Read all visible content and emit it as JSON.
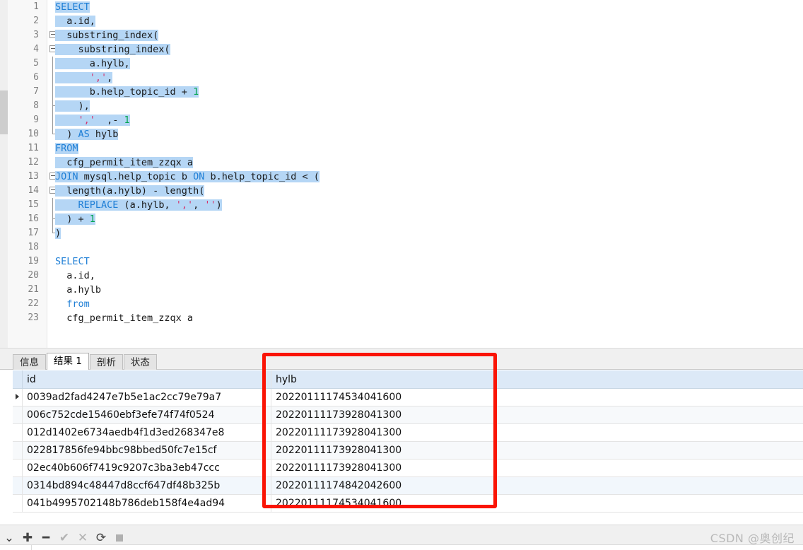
{
  "editor": {
    "language": "sql",
    "total_lines": 23,
    "selection_active": true,
    "colors": {
      "keyword": "#1f7fd6",
      "string": "#d6336c",
      "number": "#00a550",
      "plain": "#1a1a1a",
      "selection": "#b5d6f5",
      "gutter_bg": "#f8f8f8",
      "line_number": "#808080"
    },
    "lines": [
      {
        "n": "1",
        "fold": "none",
        "selected": true,
        "tokens": [
          {
            "t": "SELECT",
            "c": "kw"
          }
        ]
      },
      {
        "n": "2",
        "fold": "none",
        "selected": true,
        "tokens": [
          {
            "t": "  a.id,",
            "c": "pln"
          }
        ]
      },
      {
        "n": "3",
        "fold": "box",
        "selected": true,
        "tokens": [
          {
            "t": "  substring_index(",
            "c": "pln"
          }
        ]
      },
      {
        "n": "4",
        "fold": "box",
        "selected": true,
        "tokens": [
          {
            "t": "    substring_index(",
            "c": "pln"
          }
        ]
      },
      {
        "n": "5",
        "fold": "line",
        "selected": true,
        "tokens": [
          {
            "t": "      a.hylb,",
            "c": "pln"
          }
        ]
      },
      {
        "n": "6",
        "fold": "line",
        "selected": true,
        "tokens": [
          {
            "t": "      ",
            "c": "pln"
          },
          {
            "t": "','",
            "c": "str"
          },
          {
            "t": ",",
            "c": "pln"
          }
        ]
      },
      {
        "n": "7",
        "fold": "line",
        "selected": true,
        "tokens": [
          {
            "t": "      b.help_topic_id + ",
            "c": "pln"
          },
          {
            "t": "1",
            "c": "num"
          }
        ]
      },
      {
        "n": "8",
        "fold": "tick",
        "selected": true,
        "tokens": [
          {
            "t": "    ),",
            "c": "pln"
          }
        ]
      },
      {
        "n": "9",
        "fold": "line",
        "selected": true,
        "tokens": [
          {
            "t": "    ",
            "c": "pln"
          },
          {
            "t": "','",
            "c": "str"
          },
          {
            "t": "  ,- ",
            "c": "pln"
          },
          {
            "t": "1",
            "c": "num"
          }
        ]
      },
      {
        "n": "10",
        "fold": "end",
        "selected": true,
        "tokens": [
          {
            "t": "  ) ",
            "c": "pln"
          },
          {
            "t": "AS",
            "c": "kw"
          },
          {
            "t": " hylb",
            "c": "pln"
          }
        ]
      },
      {
        "n": "11",
        "fold": "none",
        "selected": true,
        "tokens": [
          {
            "t": "FROM",
            "c": "kw"
          }
        ]
      },
      {
        "n": "12",
        "fold": "none",
        "selected": true,
        "tokens": [
          {
            "t": "  cfg_permit_item_zzqx a",
            "c": "pln"
          }
        ]
      },
      {
        "n": "13",
        "fold": "box",
        "selected": true,
        "tokens": [
          {
            "t": "JOIN",
            "c": "kw"
          },
          {
            "t": " mysql.help_topic b ",
            "c": "pln"
          },
          {
            "t": "ON",
            "c": "kw"
          },
          {
            "t": " b.help_topic_id < (",
            "c": "pln"
          }
        ]
      },
      {
        "n": "14",
        "fold": "box",
        "selected": true,
        "tokens": [
          {
            "t": "  length(a.hylb) - length(",
            "c": "pln"
          }
        ]
      },
      {
        "n": "15",
        "fold": "line",
        "selected": true,
        "tokens": [
          {
            "t": "    ",
            "c": "pln"
          },
          {
            "t": "REPLACE",
            "c": "kw"
          },
          {
            "t": " (a.hylb, ",
            "c": "pln"
          },
          {
            "t": "','",
            "c": "str"
          },
          {
            "t": ", ",
            "c": "pln"
          },
          {
            "t": "''",
            "c": "str"
          },
          {
            "t": ")",
            "c": "pln"
          }
        ]
      },
      {
        "n": "16",
        "fold": "tick",
        "selected": true,
        "tokens": [
          {
            "t": "  ) + ",
            "c": "pln"
          },
          {
            "t": "1",
            "c": "num"
          }
        ]
      },
      {
        "n": "17",
        "fold": "end",
        "selected": true,
        "tokens": [
          {
            "t": ")",
            "c": "pln"
          }
        ]
      },
      {
        "n": "18",
        "fold": "none",
        "selected": false,
        "tokens": []
      },
      {
        "n": "19",
        "fold": "none",
        "selected": false,
        "tokens": [
          {
            "t": "SELECT",
            "c": "kw"
          }
        ]
      },
      {
        "n": "20",
        "fold": "none",
        "selected": false,
        "tokens": [
          {
            "t": "  a.id,",
            "c": "pln"
          }
        ]
      },
      {
        "n": "21",
        "fold": "none",
        "selected": false,
        "tokens": [
          {
            "t": "  a.hylb",
            "c": "pln"
          }
        ]
      },
      {
        "n": "22",
        "fold": "none",
        "selected": false,
        "tokens": [
          {
            "t": "  from",
            "c": "kw"
          }
        ]
      },
      {
        "n": "23",
        "fold": "none",
        "selected": false,
        "tokens": [
          {
            "t": "  cfg_permit_item_zzqx a",
            "c": "pln"
          }
        ]
      }
    ]
  },
  "results": {
    "tabs": [
      {
        "label": "信息",
        "active": false
      },
      {
        "label": "结果 1",
        "active": true
      },
      {
        "label": "剖析",
        "active": false
      },
      {
        "label": "状态",
        "active": false
      }
    ],
    "columns": [
      "id",
      "hylb"
    ],
    "rows": [
      {
        "id": "0039ad2fad4247e7b5e1ac2cc79e79a7",
        "hylb": "20220111174534041600",
        "current": true
      },
      {
        "id": "006c752cde15460ebf3efe74f74f0524",
        "hylb": "20220111173928041300",
        "current": false
      },
      {
        "id": "012d1402e6734aedb4f1d3ed268347e8",
        "hylb": "20220111173928041300",
        "current": false
      },
      {
        "id": "022817856fe94bbc98bbed50fc7e15cf",
        "hylb": "20220111173928041300",
        "current": false
      },
      {
        "id": "02ec40b606f7419c9207c3ba3eb47ccc",
        "hylb": "20220111173928041300",
        "current": false
      },
      {
        "id": "0314bd894c48447d8ccf647df48b325b",
        "hylb": "20220111174842042600",
        "current": false
      },
      {
        "id": "041b4995702148b786deb158f4e4ad94",
        "hylb": "20220111174534041600",
        "current": false
      }
    ]
  },
  "annotation": {
    "shape": "rectangle",
    "color": "#fa1405",
    "targets_column": "hylb"
  },
  "toolbar": {
    "buttons": [
      {
        "name": "chevron-down-icon",
        "glyph": "⌄",
        "enabled": true
      },
      {
        "name": "add-record-icon",
        "glyph": "✚",
        "enabled": true
      },
      {
        "name": "remove-record-icon",
        "glyph": "━",
        "enabled": true
      },
      {
        "name": "apply-change-icon",
        "glyph": "✔",
        "enabled": false
      },
      {
        "name": "cancel-change-icon",
        "glyph": "✕",
        "enabled": false
      },
      {
        "name": "refresh-icon",
        "glyph": "⟳",
        "enabled": true
      },
      {
        "name": "stop-icon",
        "glyph": "",
        "enabled": false
      }
    ]
  },
  "watermark": {
    "text": "CSDN @奥创纪"
  }
}
